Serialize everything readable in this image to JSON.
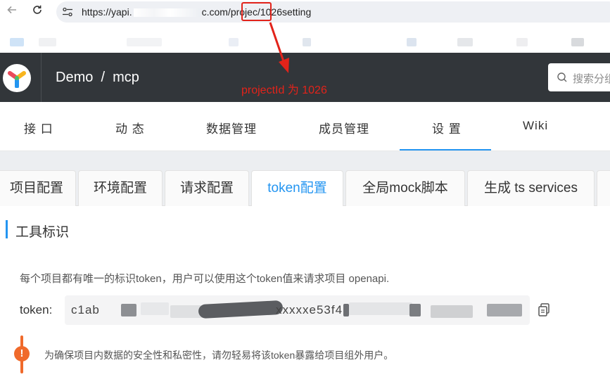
{
  "browser": {
    "url_prefix": "https://yapi.",
    "url_middle": "c.com/projec",
    "url_project_id": "/1026",
    "url_suffix": "setting"
  },
  "header": {
    "breadcrumb": "Demo  /  mcp",
    "search_placeholder": "搜索分组"
  },
  "annotation": {
    "text": "projectId 为 1026",
    "color": "#e2231a"
  },
  "main_tabs": [
    {
      "label": "接 口"
    },
    {
      "label": "动 态"
    },
    {
      "label": "数据管理"
    },
    {
      "label": "成员管理"
    },
    {
      "label": "设 置",
      "active": true
    },
    {
      "label": "Wiki"
    }
  ],
  "sub_tabs": [
    {
      "label": "项目配置"
    },
    {
      "label": "环境配置"
    },
    {
      "label": "请求配置"
    },
    {
      "label": "token配置",
      "active": true
    },
    {
      "label": "全局mock脚本"
    },
    {
      "label": "生成 ts services"
    }
  ],
  "content": {
    "section_title": "工具标识",
    "description": "每个项目都有唯一的标识token，用户可以使用这个token值来请求项目 openapi.",
    "token_label": "token:",
    "token_visible": "c1ab",
    "token_visible_mid": "xxxxxe53f4",
    "warning_text": "为确保项目内数据的安全性和私密性，请勿轻易将该token暴露给项目组外用户。"
  },
  "colors": {
    "accent": "#2395f1",
    "header_bg": "#32363a",
    "warning": "#f06a2b"
  },
  "icons": [
    "back-arrow-icon",
    "reload-icon",
    "site-settings-icon",
    "yapi-logo-icon",
    "search-icon",
    "copy-icon",
    "warning-icon"
  ]
}
